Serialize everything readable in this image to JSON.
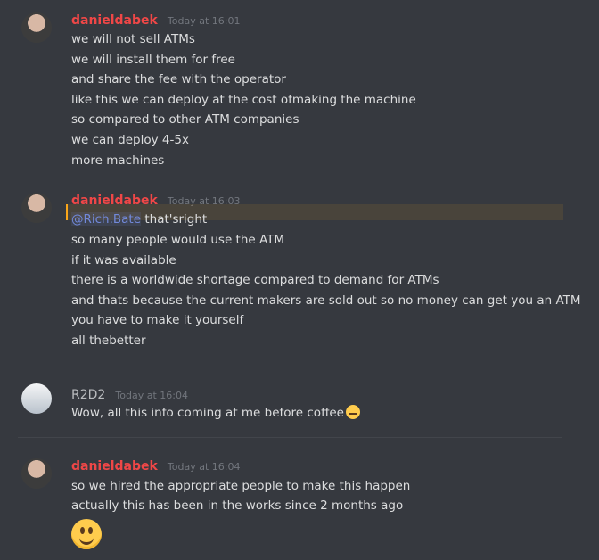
{
  "messages": [
    {
      "author": "danieldabek",
      "time": "Today at 16:01",
      "lines": [
        "we will not sell ATMs",
        "we will install them for free",
        "and share the fee with the operator",
        "like this we can deploy at the cost ofmaking the machine",
        "so compared to other ATM companies",
        "we can deploy 4-5x",
        "more machines"
      ]
    },
    {
      "author": "danieldabek",
      "time": "Today at 16:03",
      "mention": "@Rich.Bate",
      "mention_rest": " that'sright",
      "lines": [
        "so many people would use the ATM",
        "if it was available",
        "there is a worldwide shortage compared to demand for ATMs",
        "and thats because the current makers are sold out so no money can get you an ATM",
        "you have to make it yourself",
        "all thebetter"
      ]
    },
    {
      "author": "R2D2",
      "time": "Today at 16:04",
      "lines": [
        "Wow, all this info coming at me before coffee"
      ],
      "emoji": "grimacing-emoji"
    },
    {
      "author": "danieldabek",
      "time": "Today at 16:04",
      "lines": [
        "so we hired the appropriate people to make this happen",
        "actually this has been in the works since 2 months ago"
      ],
      "big_emoji": "smiley-emoji"
    }
  ],
  "colors": {
    "background": "#36393f",
    "author_daniel": "#f04747",
    "author_r2": "#b9bbbe",
    "timestamp": "#72767d",
    "mention": "#7289da"
  }
}
